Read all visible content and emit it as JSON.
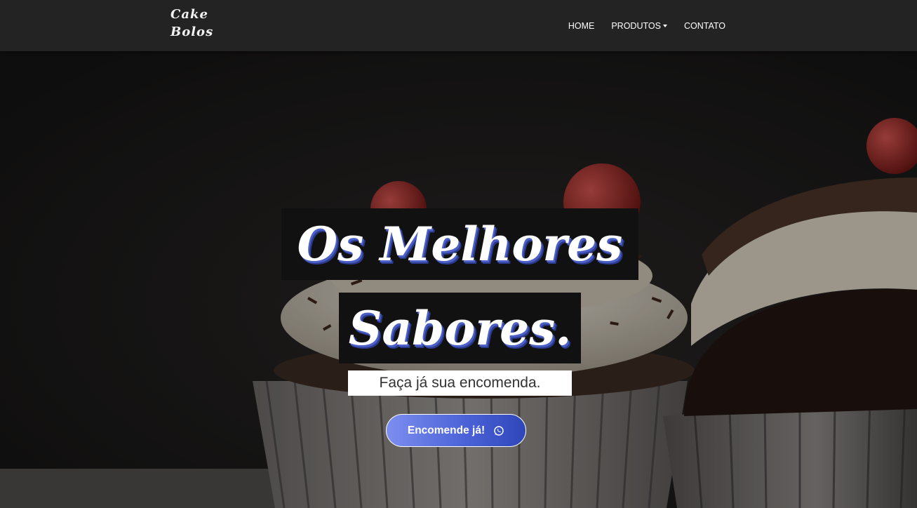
{
  "brand": {
    "line1": "Cake",
    "line2": "Bolos"
  },
  "nav": {
    "items": [
      {
        "label": "HOME"
      },
      {
        "label": "PRODUTOS",
        "has_dropdown": true
      },
      {
        "label": "CONTATO"
      }
    ]
  },
  "hero": {
    "headline_line1": "Os Melhores",
    "headline_line2": "Sabores.",
    "subtitle": "Faça já sua encomenda.",
    "cta_label": "Encomende já!",
    "cta_icon": "whatsapp-icon",
    "background_image": "dark photo of chocolate cupcakes with cream and cherries"
  },
  "colors": {
    "navbar_bg": "#232323",
    "headline_box_bg": "#111111",
    "headline_shadow": "#4b5fc7",
    "cta_gradient_start": "#7d8ef0",
    "cta_gradient_end": "#2e46b8"
  }
}
